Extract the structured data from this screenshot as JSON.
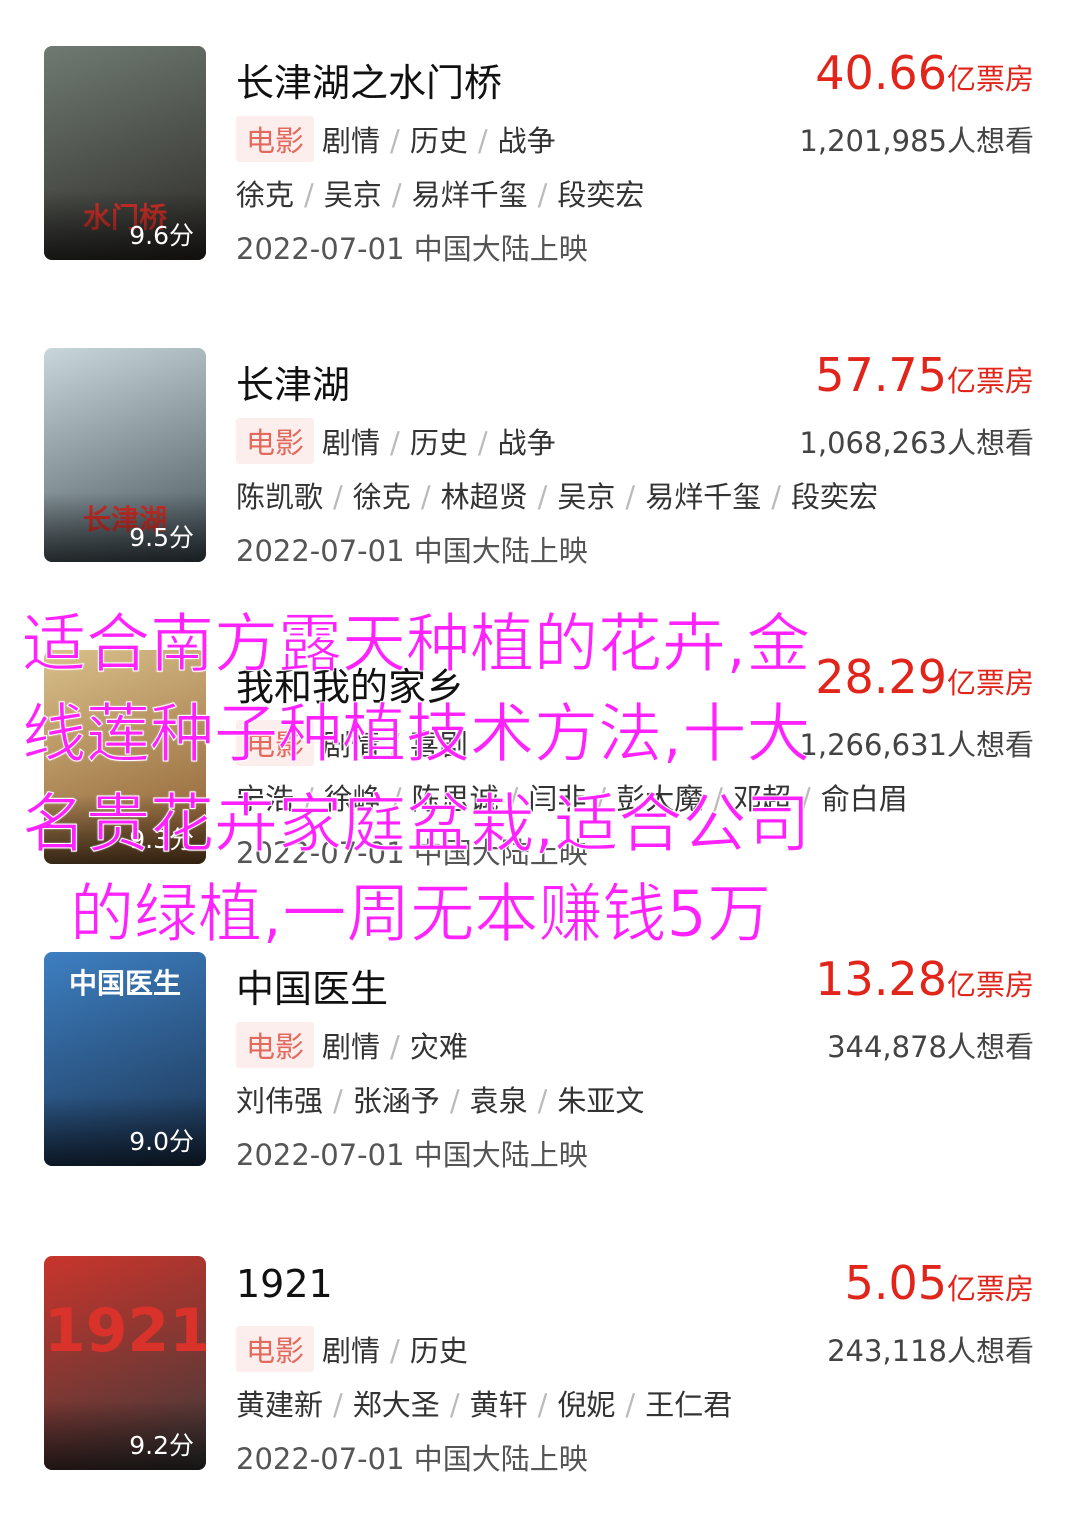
{
  "movies": [
    {
      "title": "长津湖之水门桥",
      "box_value": "40.66",
      "box_unit": "亿票房",
      "tag": "电影",
      "genres": [
        "剧情",
        "历史",
        "战争"
      ],
      "want": "1,201,985人想看",
      "cast": [
        "徐克",
        "吴京",
        "易烊千玺",
        "段奕宏"
      ],
      "release": "2022-07-01 中国大陆上映",
      "score": "9.6分",
      "poster_art_text": "水门桥",
      "poster_colors": [
        "#6f7a72",
        "#2d2a27"
      ]
    },
    {
      "title": "长津湖",
      "box_value": "57.75",
      "box_unit": "亿票房",
      "tag": "电影",
      "genres": [
        "剧情",
        "历史",
        "战争"
      ],
      "want": "1,068,263人想看",
      "cast": [
        "陈凯歌",
        "徐克",
        "林超贤",
        "吴京",
        "易烊千玺",
        "段奕宏"
      ],
      "release": "2022-07-01 中国大陆上映",
      "score": "9.5分",
      "poster_art_text": "长津湖",
      "poster_colors": [
        "#c9d6dc",
        "#47555b"
      ]
    },
    {
      "title": "我和我的家乡",
      "box_value": "28.29",
      "box_unit": "亿票房",
      "tag": "电影",
      "genres": [
        "剧情",
        "喜剧"
      ],
      "want": "1,266,631人想看",
      "cast": [
        "宁浩",
        "徐峥",
        "陈思诚",
        "闫非",
        "彭大魔",
        "邓超",
        "俞白眉"
      ],
      "release": "2022-07-01 中国大陆上映",
      "score": "9.3分",
      "poster_art_text": "",
      "poster_colors": [
        "#d9c08a",
        "#8a5a2e"
      ]
    },
    {
      "title": "中国医生",
      "box_value": "13.28",
      "box_unit": "亿票房",
      "tag": "电影",
      "genres": [
        "剧情",
        "灾难"
      ],
      "want": "344,878人想看",
      "cast": [
        "刘伟强",
        "张涵予",
        "袁泉",
        "朱亚文"
      ],
      "release": "2022-07-01 中国大陆上映",
      "score": "9.0分",
      "poster_art_text": "中国医生",
      "poster_colors": [
        "#3d7fc2",
        "#1c3350"
      ]
    },
    {
      "title": "1921",
      "box_value": "5.05",
      "box_unit": "亿票房",
      "tag": "电影",
      "genres": [
        "剧情",
        "历史"
      ],
      "want": "243,118人想看",
      "cast": [
        "黄建新",
        "郑大圣",
        "黄轩",
        "倪妮",
        "王仁君"
      ],
      "release": "2022-07-01 中国大陆上映",
      "score": "9.2分",
      "poster_art_text": "1921",
      "poster_colors": [
        "#c9352c",
        "#3a3a3a"
      ]
    }
  ],
  "overlay_text": {
    "line1": "适合南方露天种植的花卉,金",
    "line2": "线莲种子种植技术方法,十大",
    "line3": "名贵花卉家庭盆栽,适合公司",
    "line4": "的绿植,一周无本赚钱5万"
  },
  "colors": {
    "accent": "#e1251b",
    "overlay": "#ff22ff",
    "chip_bg": "#fdeeee",
    "chip_text": "#e26a5d"
  }
}
